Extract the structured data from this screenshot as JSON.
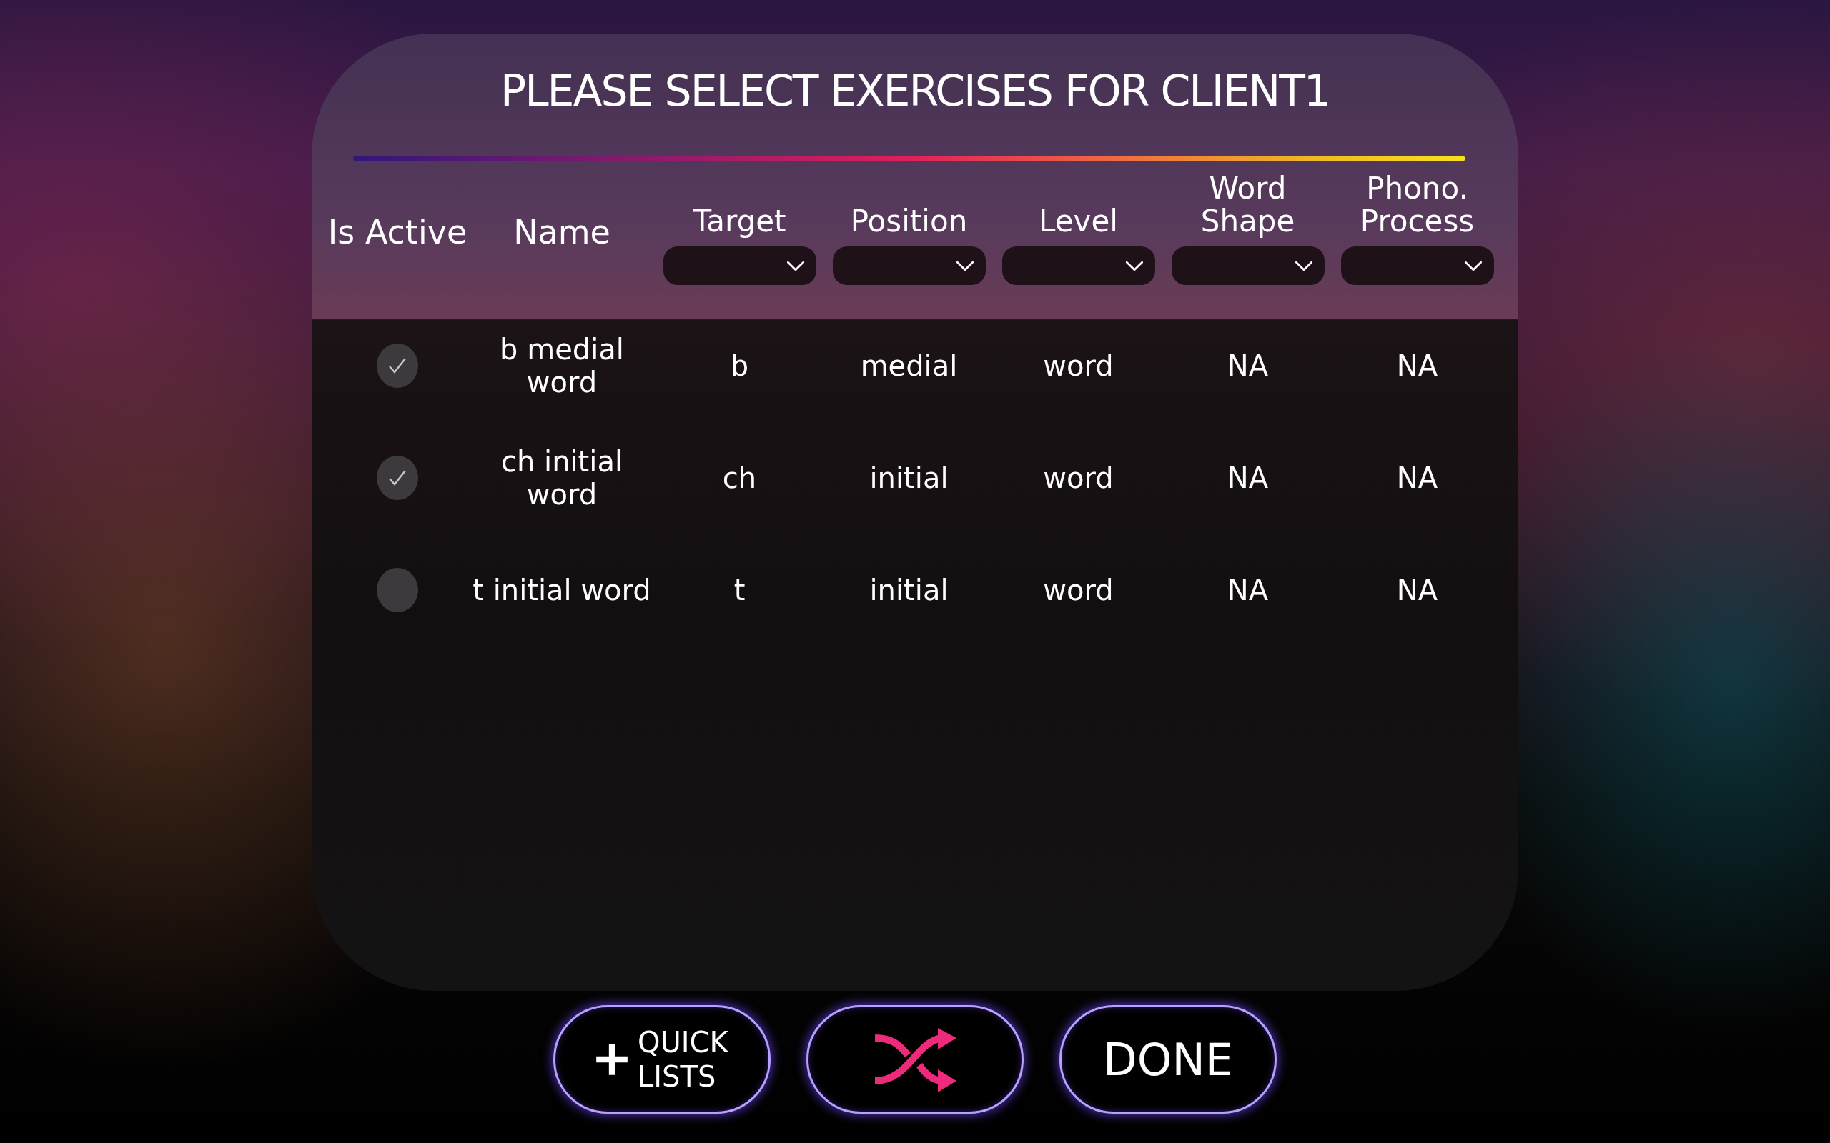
{
  "dialog": {
    "title": "PLEASE SELECT EXERCISES FOR CLIENT1"
  },
  "table": {
    "columns": [
      {
        "label": "Is Active",
        "filter": false
      },
      {
        "label": "Name",
        "filter": false
      },
      {
        "label": "Target",
        "filter": true
      },
      {
        "label": "Position",
        "filter": true
      },
      {
        "label": "Level",
        "filter": true
      },
      {
        "label": "Word Shape",
        "filter": true
      },
      {
        "label": "Phono. Process",
        "filter": true
      }
    ],
    "rows": [
      {
        "is_active": true,
        "name": "b medial word",
        "target": "b",
        "position": "medial",
        "level": "word",
        "word_shape": "NA",
        "phono_process": "NA"
      },
      {
        "is_active": true,
        "name": "ch initial word",
        "target": "ch",
        "position": "initial",
        "level": "word",
        "word_shape": "NA",
        "phono_process": "NA"
      },
      {
        "is_active": false,
        "name": "t initial word",
        "target": "t",
        "position": "initial",
        "level": "word",
        "word_shape": "NA",
        "phono_process": "NA"
      }
    ]
  },
  "buttons": [
    {
      "kind": "add",
      "label": "QUICK LISTS"
    },
    {
      "kind": "shuffle"
    },
    {
      "kind": "text",
      "label": "DONE"
    }
  ]
}
